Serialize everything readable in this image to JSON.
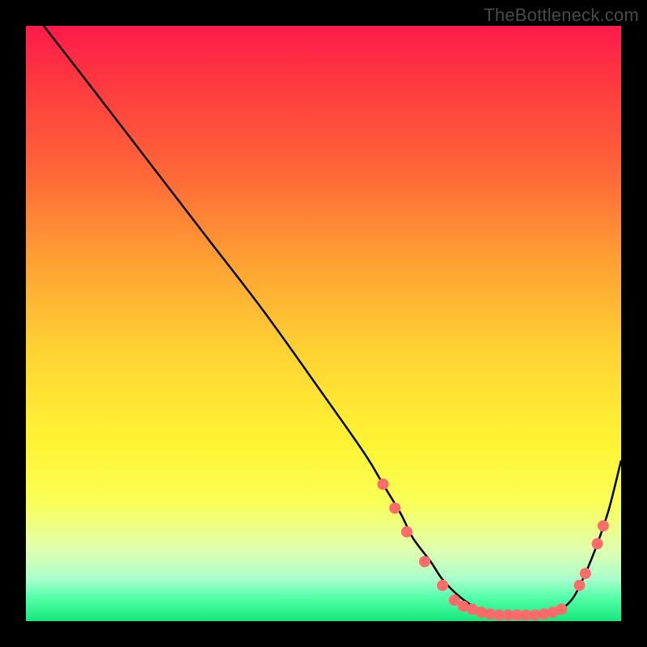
{
  "watermark": "TheBottleneck.com",
  "chart_data": {
    "type": "line",
    "title": "",
    "xlabel": "",
    "ylabel": "",
    "xlim": [
      0,
      100
    ],
    "ylim": [
      0,
      100
    ],
    "legend": false,
    "grid": false,
    "background": "rainbow-vertical-gradient",
    "series": [
      {
        "name": "bottleneck-curve",
        "color": "#000000",
        "x": [
          3,
          10,
          20,
          30,
          40,
          50,
          57,
          60,
          63,
          65,
          68,
          70,
          73,
          76,
          78,
          80,
          82,
          84,
          86,
          88,
          90,
          92,
          94,
          96,
          98,
          100
        ],
        "y": [
          100,
          91,
          78,
          65,
          52,
          38,
          28,
          23,
          18,
          14,
          10,
          7,
          4,
          2,
          1.2,
          1,
          1,
          1,
          1,
          1.2,
          2,
          4,
          8,
          13,
          19,
          27
        ]
      }
    ],
    "markers": {
      "name": "highlight-dots",
      "color": "#ff6a6a",
      "radius": 7,
      "points": [
        {
          "x": 60,
          "y": 23
        },
        {
          "x": 62,
          "y": 19
        },
        {
          "x": 64,
          "y": 15
        },
        {
          "x": 67,
          "y": 10
        },
        {
          "x": 70,
          "y": 6
        },
        {
          "x": 72,
          "y": 3.5
        },
        {
          "x": 73.5,
          "y": 2.5
        },
        {
          "x": 75,
          "y": 2
        },
        {
          "x": 76.5,
          "y": 1.5
        },
        {
          "x": 78,
          "y": 1.2
        },
        {
          "x": 79.5,
          "y": 1
        },
        {
          "x": 81,
          "y": 1
        },
        {
          "x": 82.5,
          "y": 1
        },
        {
          "x": 84,
          "y": 1
        },
        {
          "x": 85.5,
          "y": 1
        },
        {
          "x": 87,
          "y": 1.2
        },
        {
          "x": 88.5,
          "y": 1.5
        },
        {
          "x": 90,
          "y": 2
        },
        {
          "x": 93,
          "y": 6
        },
        {
          "x": 94,
          "y": 8
        },
        {
          "x": 96,
          "y": 13
        },
        {
          "x": 97,
          "y": 16
        }
      ]
    }
  }
}
